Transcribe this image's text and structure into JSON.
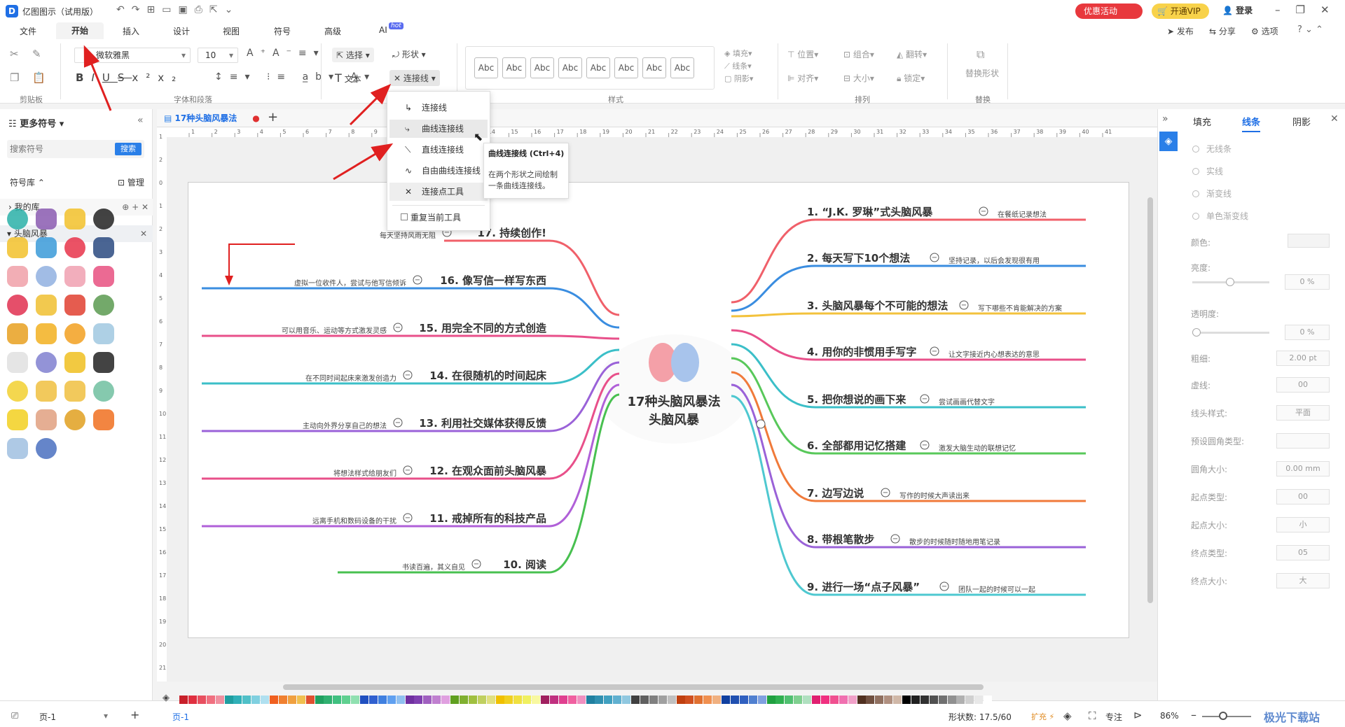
{
  "app": {
    "title": "亿图图示（试用版）",
    "promo": "优惠活动",
    "vip": "开通VIP",
    "login": "登录"
  },
  "menus": [
    "文件",
    "开始",
    "插入",
    "设计",
    "视图",
    "符号",
    "高级",
    "AI"
  ],
  "ai_badge": "hot",
  "top_right": {
    "publish": "发布",
    "share": "分享",
    "options": "选项"
  },
  "ribbon": {
    "font_name": "微软雅黑",
    "font_size": "10",
    "groups": {
      "clipboard": "剪贴板",
      "font": "字体和段落",
      "style": "样式",
      "arrange": "排列",
      "replace": "替换"
    },
    "select": "选择",
    "shape": "形状",
    "text": "文本",
    "connector": "连接线",
    "abc": [
      "Abc",
      "Abc",
      "Abc",
      "Abc",
      "Abc",
      "Abc",
      "Abc",
      "Abc"
    ],
    "fill": "填充",
    "line": "线条",
    "shadow": "阴影",
    "position": "位置",
    "combine": "组合",
    "flip": "翻转",
    "align": "对齐",
    "size": "大小",
    "lock": "锁定",
    "replace_shape": "替换形状"
  },
  "dropdown": {
    "items": [
      "连接线",
      "曲线连接线",
      "直线连接线",
      "自由曲线连接线",
      "连接点工具"
    ],
    "repeat": "重复当前工具"
  },
  "tooltip": {
    "title": "曲线连接线 (Ctrl+4)",
    "body_l1": "在两个形状之间绘制",
    "body_l2": "一条曲线连接线。"
  },
  "leftpanel": {
    "header": "更多符号",
    "search_placeholder": "搜索符号",
    "search_btn": "搜索",
    "lib": "符号库",
    "manage": "管理",
    "mylib": "我的库",
    "category": "头脑风暴"
  },
  "doc_tab": "17种头脑风暴法",
  "ruler": {
    "top": [
      "1",
      "2",
      "3",
      "4",
      "5",
      "6",
      "7",
      "8",
      "9",
      "10",
      "11",
      "12",
      "13",
      "14",
      "15",
      "16",
      "17",
      "18",
      "19",
      "20",
      "21",
      "22",
      "23",
      "24",
      "25",
      "26",
      "27",
      "28",
      "29",
      "30",
      "31",
      "32",
      "33",
      "34",
      "35",
      "36",
      "37",
      "38",
      "39",
      "40",
      "41"
    ],
    "left": [
      "1",
      "2",
      "0",
      "1",
      "2",
      "3",
      "4",
      "5",
      "6",
      "7",
      "8",
      "9",
      "10",
      "11",
      "12",
      "13",
      "14",
      "15",
      "16",
      "17",
      "18",
      "19",
      "20",
      "21"
    ]
  },
  "mindmap": {
    "center_l1": "17种头脑风暴法",
    "center_l2": "头脑风暴",
    "right": [
      {
        "title": "1. “J.K. 罗琳”式头脑风暴",
        "sub": "在餐纸记录想法",
        "color": "#f0606a"
      },
      {
        "title": "2. 每天写下10个想法",
        "sub": "坚持记录，以后会发现很有用",
        "color": "#3a8de0"
      },
      {
        "title": "3. 头脑风暴每个不可能的想法",
        "sub": "写下哪些不肯能解决的方案",
        "color": "#f3c23c"
      },
      {
        "title": "4. 用你的非惯用手写字",
        "sub": "让文字接近内心想表达的意思",
        "color": "#e8508a"
      },
      {
        "title": "5. 把你想说的画下来",
        "sub": "尝试画画代替文字",
        "color": "#3bbfc8"
      },
      {
        "title": "6. 全部都用记忆搭建",
        "sub": "激发大脑生动的联想记忆",
        "color": "#58c85a"
      },
      {
        "title": "7. 边写边说",
        "sub": "写作的时候大声读出来",
        "color": "#f07a3a"
      },
      {
        "title": "8. 带根笔散步",
        "sub": "散步的时候随时随地用笔记录",
        "color": "#9a62d8"
      },
      {
        "title": "9. 进行一场“点子风暴”",
        "sub": "团队一起的时候可以一起",
        "color": "#4ec8d0"
      }
    ],
    "left": [
      {
        "title": "17. 持续创作!",
        "sub": "每天坚持风雨无阻",
        "color": "#f0606a"
      },
      {
        "title": "16. 像写信一样写东西",
        "sub": "虚拟一位收件人，尝试与他写信倾诉",
        "color": "#3a8de0"
      },
      {
        "title": "15. 用完全不同的方式创造",
        "sub": "可以用音乐、运动等方式激发灵感",
        "color": "#e8508a"
      },
      {
        "title": "14. 在很随机的时间起床",
        "sub": "在不同时间起床来激发创造力",
        "color": "#3bbfc8"
      },
      {
        "title": "13. 利用社交媒体获得反馈",
        "sub": "主动向外界分享自己的想法",
        "color": "#9a62d8"
      },
      {
        "title": "12. 在观众面前头脑风暴",
        "sub": "将想法样式给朋友们",
        "color": "#e8508a"
      },
      {
        "title": "11. 戒掉所有的科技产品",
        "sub": "远离手机和数码设备的干扰",
        "color": "#b060d8"
      },
      {
        "title": "10. 阅读",
        "sub": "书读百遍，其义自见",
        "color": "#48c050"
      }
    ]
  },
  "rightpanel": {
    "tabs": [
      "填充",
      "线条",
      "阴影"
    ],
    "radios": [
      "无线条",
      "实线",
      "渐变线",
      "单色渐变线"
    ],
    "rows": [
      "颜色:",
      "亮度:",
      "透明度:",
      "粗细:",
      "虚线:",
      "线头样式:",
      "预设圆角类型:",
      "圆角大小:",
      "起点类型:",
      "起点大小:",
      "终点类型:",
      "终点大小:"
    ],
    "brightness": "0 %",
    "opacity": "0 %",
    "weight": "2.00 pt",
    "dash": "00",
    "cap": "平面",
    "radius": "0.00 mm",
    "start_type": "00",
    "start_size": "小",
    "end_type": "05",
    "end_size": "大"
  },
  "statusbar": {
    "page": "页-1",
    "page_tab": "页-1",
    "shape_count": "形状数: 17.5/60",
    "expand": "扩充",
    "focus": "专注",
    "zoom": "86%",
    "watermark": "极光下载站"
  },
  "palette": [
    "#c8202a",
    "#e03040",
    "#e85060",
    "#f07080",
    "#f090a0",
    "#1f9ea0",
    "#30b0b8",
    "#50c0c8",
    "#80d0e0",
    "#b0e0f0",
    "#f06020",
    "#f08030",
    "#f0a040",
    "#f0c050",
    "#e05030",
    "#20a060",
    "#30b070",
    "#40c080",
    "#60d090",
    "#90e0b0",
    "#2050c0",
    "#3060d0",
    "#4080e0",
    "#60a0f0",
    "#90c0f0",
    "#7030a0",
    "#8040b0",
    "#a060c0",
    "#c080d0",
    "#e0a0e0",
    "#60a020",
    "#80b030",
    "#a0c040",
    "#c0d060",
    "#e0e080",
    "#f0c000",
    "#f0d020",
    "#f0e040",
    "#f0f060",
    "#f8f8a0",
    "#a02060",
    "#c03080",
    "#e04090",
    "#f060a0",
    "#f090c0",
    "#2080a0",
    "#3090b0",
    "#40a0c0",
    "#60b0d0",
    "#90c8e0",
    "#404040",
    "#606060",
    "#808080",
    "#a0a0a0",
    "#c0c0c0",
    "#c04010",
    "#d05020",
    "#e07030",
    "#f09050",
    "#f0b080",
    "#1040a0",
    "#2050b0",
    "#3060c0",
    "#5080d0",
    "#80a0e0",
    "#20a040",
    "#30b050",
    "#50c070",
    "#80d090",
    "#b0e0c0",
    "#e02070",
    "#f03080",
    "#f05090",
    "#f070b0",
    "#f0a0c8",
    "#503020",
    "#705040",
    "#907060",
    "#b09080",
    "#d0b8a8",
    "#000000",
    "#202020",
    "#303030",
    "#505050",
    "#707070",
    "#909090",
    "#b0b0b0",
    "#d0d0d0",
    "#e8e8e8",
    "#ffffff"
  ]
}
